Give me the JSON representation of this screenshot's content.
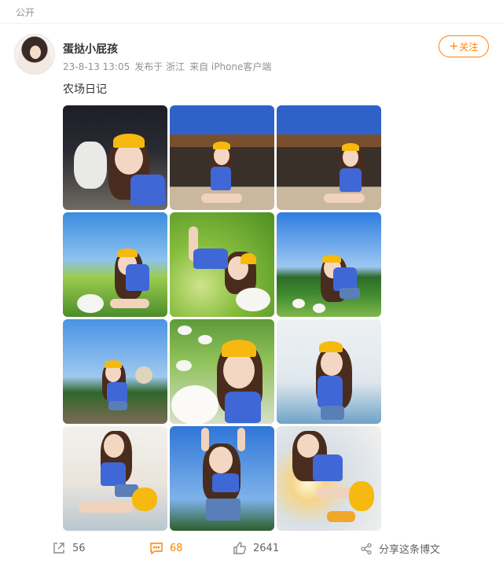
{
  "visibility_label": "公开",
  "user": {
    "name": "蛋挞小屁孩",
    "follow_label": "关注"
  },
  "meta": {
    "time": "23-8-13 13:05",
    "location": "发布于 浙江",
    "source": "来自 iPhone客户端"
  },
  "post": {
    "text": "农场日记"
  },
  "actions": {
    "repost_count": "56",
    "comment_count": "68",
    "like_count": "2641",
    "share_label": "分享这条博文"
  },
  "colors": {
    "accent": "#ff8200",
    "meta_gray": "#939393"
  },
  "icons": [
    "repost-icon",
    "comment-icon",
    "like-icon",
    "share-icon"
  ]
}
